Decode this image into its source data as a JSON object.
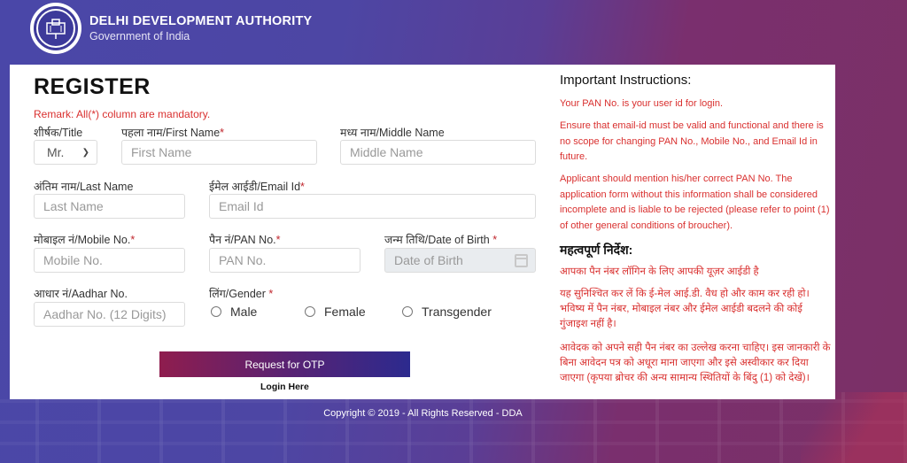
{
  "header": {
    "org_name": "DELHI DEVELOPMENT AUTHORITY",
    "org_sub": "Government of India"
  },
  "form": {
    "title": "REGISTER",
    "remark": "Remark: All(*) column are mandatory.",
    "title_field": {
      "label": "शीर्षक/Title",
      "value": "Mr."
    },
    "first_name": {
      "label": "पहला नाम/First Name",
      "placeholder": "First Name",
      "required": "*"
    },
    "middle_name": {
      "label": "मध्य नाम/Middle Name",
      "placeholder": "Middle Name"
    },
    "last_name": {
      "label": "अंतिम नाम/Last Name",
      "placeholder": "Last Name"
    },
    "email": {
      "label": "ईमेल आईडी/Email Id",
      "placeholder": "Email Id",
      "required": "*"
    },
    "mobile": {
      "label": "मोबाइल नं/Mobile No.",
      "placeholder": "Mobile No.",
      "required": "*"
    },
    "pan": {
      "label": "पैन नं/PAN No.",
      "placeholder": "PAN No.",
      "required": "*"
    },
    "dob": {
      "label": "जन्म तिथि/Date of Birth ",
      "placeholder": "Date of Birth",
      "required": "*"
    },
    "aadhar": {
      "label": "आधार नं/Aadhar No.",
      "placeholder": "Aadhar No. (12 Digits)"
    },
    "gender": {
      "label": "लिंग/Gender ",
      "required": "*",
      "options": [
        "Male",
        "Female",
        "Transgender"
      ]
    },
    "otp_button": "Request for OTP",
    "login_link": "Login Here"
  },
  "instructions": {
    "title": "Important Instructions:",
    "en": [
      "Your PAN No. is your user id for login.",
      "Ensure that email-id must be valid and functional and there is no scope for changing PAN No., Mobile No., and Email Id in future.",
      "Applicant should mention his/her correct PAN No. The application form without this information shall be considered incomplete and is liable to be rejected (please refer to point (1) of other general conditions of broucher)."
    ],
    "hi_title": "महत्वपूर्ण निर्देश:",
    "hi": [
      "आपका पैन नंबर लॉगिन के लिए आपकी यूज़र आईडी है",
      "यह सुनिश्चित कर लें कि ई-मेल आई.डी. वैध हो और काम कर रही हो। भविष्य में पैन नंबर, मोबाइल नंबर और ईमेल आईडी बदलने की कोई गुंजाइश नहीं है।",
      "आवेदक को अपने सही पैन नंबर का उल्लेख करना चाहिए। इस जानकारी के बिना आवेदन पत्र को अधूरा माना जाएगा और इसे अस्वीकार कर दिया जाएगा (कृपया ब्रोचर की अन्य सामान्य स्थितियों के बिंदु (1) को देखें)।"
    ]
  },
  "footer": {
    "copyright": "Copyright © 2019 - All Rights Reserved - DDA"
  }
}
